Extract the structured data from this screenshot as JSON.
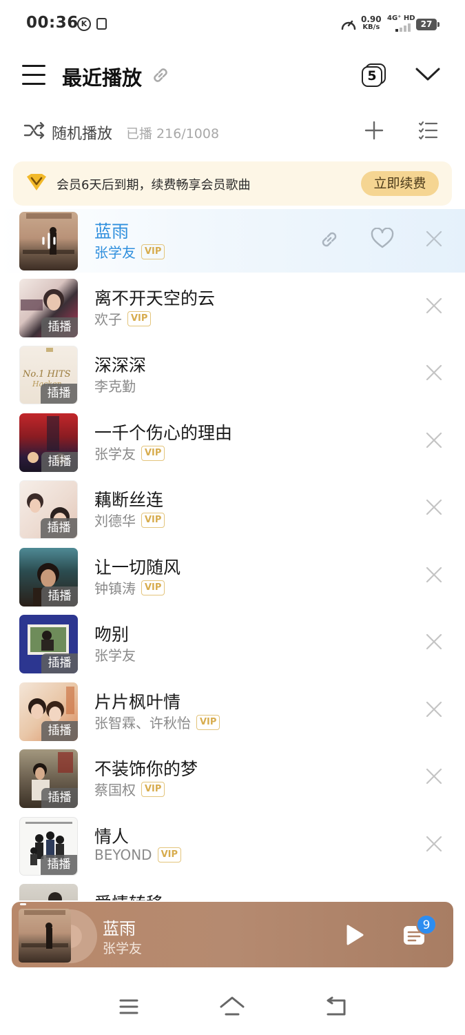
{
  "status_bar": {
    "time": "00:36",
    "speed_value": "0.90",
    "speed_unit": "KB/s",
    "network": "4G⁺ HD",
    "battery": "27"
  },
  "header": {
    "title": "最近播放",
    "queue_count": "5"
  },
  "toolbar": {
    "shuffle_label": "随机播放",
    "played_count": "已播 216/1008"
  },
  "vip_banner": {
    "text": "会员6天后到期，续费畅享会员歌曲",
    "button": "立即续费"
  },
  "songs": [
    {
      "title": "蓝雨",
      "artist": "张学友",
      "vip": "VIP",
      "badge": "",
      "playing": true
    },
    {
      "title": "离不开天空的云",
      "artist": "欢子",
      "vip": "VIP",
      "badge": "插播"
    },
    {
      "title": "深深深",
      "artist": "李克勤",
      "vip": "",
      "badge": "插播"
    },
    {
      "title": "一千个伤心的理由",
      "artist": "张学友",
      "vip": "VIP",
      "badge": "插播"
    },
    {
      "title": "藕断丝连",
      "artist": "刘德华",
      "vip": "VIP",
      "badge": "插播"
    },
    {
      "title": "让一切随风",
      "artist": "钟镇涛",
      "vip": "VIP",
      "badge": "插播"
    },
    {
      "title": "吻别",
      "artist": "张学友",
      "vip": "",
      "badge": "插播"
    },
    {
      "title": "片片枫叶情",
      "artist": "张智霖、许秋怡",
      "vip": "VIP",
      "badge": "插播"
    },
    {
      "title": "不装饰你的梦",
      "artist": "蔡国权",
      "vip": "VIP",
      "badge": "插播"
    },
    {
      "title": "情人",
      "artist": "BEYOND",
      "vip": "VIP",
      "badge": "插播"
    },
    {
      "title": "爱情转移",
      "artist": "",
      "vip": "",
      "badge": ""
    }
  ],
  "player": {
    "title": "蓝雨",
    "artist": "张学友",
    "queue_badge": "9"
  },
  "colors": {
    "accent_blue": "#2f8fdd",
    "vip_gold": "#d7ac4e",
    "banner_bg": "#fdf6e6",
    "player_bg": "#b8886a"
  }
}
